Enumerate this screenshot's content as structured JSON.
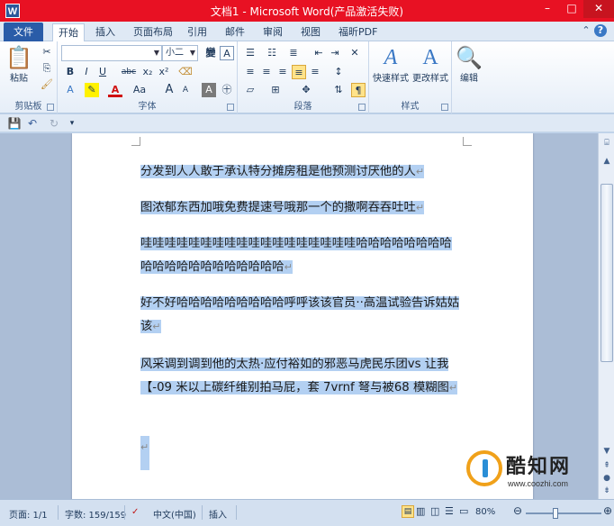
{
  "window": {
    "title": "文档1 - Microsoft Word(产品激活失败)",
    "app_icon_letter": "W",
    "minimize": "–",
    "maximize": "□",
    "close": "✕"
  },
  "tabs": {
    "file": "文件",
    "items": [
      "开始",
      "插入",
      "页面布局",
      "引用",
      "邮件",
      "审阅",
      "视图",
      "福昕PDF"
    ],
    "active": "开始"
  },
  "ribbon": {
    "clipboard": {
      "label": "剪贴板",
      "paste": "粘贴"
    },
    "font": {
      "label": "字体",
      "font_name": "",
      "font_size": "小二",
      "buttons": [
        "B",
        "I",
        "U",
        "abc",
        "x₂",
        "x²",
        "A",
        "Aa",
        "A",
        "A"
      ]
    },
    "paragraph": {
      "label": "段落"
    },
    "styles": {
      "label": "样式",
      "quick_styles": "快速样式",
      "change_styles": "更改样式"
    },
    "editing": {
      "label": "编辑",
      "edit": "编辑"
    }
  },
  "document": {
    "paragraphs": [
      {
        "text": "分发到人人敢于承认特分摊房租是他预测讨厌他的人"
      },
      {
        "text": "图浓郁东西加哦免费提速号哦那一个的撒啊吞吞吐吐"
      },
      {
        "text": "哇哇哇哇哇哇哇哇哇哇哇哇哇哇哇哇哇哇哈哈哈哈哈哈哈哈哈哈哈哈哈哈哈哈哈哈哈哈"
      },
      {
        "text": "好不好哈哈哈哈哈哈哈哈哈呼呼该该官员··高温试验告诉姑姑该"
      },
      {
        "text": "风采调到调到他的太热·应付裕如的邪恶马虎民乐团vs 让我【-09 米以上碳纤维别拍马屁，套 7vrnf 弩与被68 模糊图"
      },
      {
        "text": ""
      }
    ],
    "para_mark": "↵"
  },
  "statusbar": {
    "page": "页面: 1/1",
    "words": "字数: 159/159",
    "language": "中文(中国)",
    "mode": "插入",
    "zoom": "80%",
    "zoom_level": 0.8
  },
  "watermark": {
    "text": "酷知网",
    "url": "www.coozhi.com"
  }
}
